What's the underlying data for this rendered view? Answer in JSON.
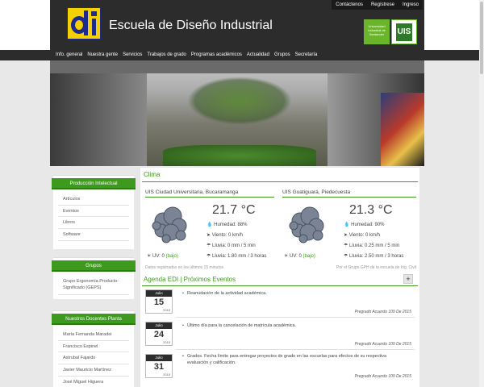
{
  "header": {
    "title": "Escuela de Diseño Industrial",
    "logo_text": "di",
    "uis_small": "Universidad Industrial de Santander",
    "uis_logo": "UIS",
    "top_links": [
      "Contáctenos",
      "Regístrese",
      "Ingreso"
    ]
  },
  "nav": {
    "items": [
      "Info. general",
      "Nuestra gente",
      "Servicios",
      "Trabajos de grado",
      "Programas académicos",
      "Actualidad",
      "Grupos",
      "Secretaría"
    ]
  },
  "sidebar": {
    "produccion": {
      "title": "Producción Intelectual",
      "items": [
        "Artículos",
        "Eventos",
        "Libros",
        "Software"
      ]
    },
    "grupos": {
      "title": "Grupos",
      "items": [
        "Grupo Ergonomía Producto-Significado (GEPS)"
      ]
    },
    "docentes": {
      "title": "Nuestros Docentes Planta",
      "items": [
        "María Fernanda Maradei",
        "Francisco Espinel",
        "Astrubal Fajardo",
        "Javier Mauricio Martínez",
        "José Miguel Higuera"
      ]
    }
  },
  "clima": {
    "title": "Clima",
    "stations": [
      {
        "name": "UIS Ciudad Universitaria, Bucaramanga",
        "temp": "21.7 °C",
        "humidity": "Humedad: 88%",
        "wind": "Viento: 0 km/h",
        "rain_rate": "Lluvia: 0 mm / 5 min",
        "rain_total": "Lluvia: 1.80 mm / 3 horas",
        "uv_label": "UV: 0",
        "uv_level": "(bajo)"
      },
      {
        "name": "UIS Guatiguará, Piedecuesta",
        "temp": "21.3 °C",
        "humidity": "Humedad: 90%",
        "wind": "Viento: 0 km/h",
        "rain_rate": "Lluvia: 0.25 mm / 5 min",
        "rain_total": "Lluvia: 2.50 mm / 3 horas",
        "uv_label": "UV: 0",
        "uv_level": "(bajo)"
      }
    ],
    "footnote_left": "Datos registrados en los últimos 15 minutos",
    "footnote_right": "Por el Grupo GPH de la escuela de Ing. Civil"
  },
  "agenda": {
    "title": "Agenda EDI | Próximos Eventos",
    "add_label": "+",
    "events": [
      {
        "month": "Julio",
        "day": "15",
        "year": "2015",
        "text": "Reanudación de la actividad académica.",
        "source": "Pregrado Acuerdo 109 De 2015"
      },
      {
        "month": "Julio",
        "day": "24",
        "year": "2015",
        "text": "Último día para la cancelación de matrícula académica.",
        "source": "Pregrado Acuerdo 109 De 2015"
      },
      {
        "month": "Julio",
        "day": "31",
        "year": "2015",
        "text": "Grados. Fecha límite para entregar proyectos de grado en las escuelas para efectos de su respectiva evaluación y calificación.",
        "source": "Pregrado Acuerdo 109 De 2015"
      }
    ]
  },
  "colors": {
    "accent_green": "#3e9a1e",
    "header_dark": "#2c2c2c",
    "logo_yellow": "#f5d100",
    "logo_blue": "#1e2a8c"
  }
}
